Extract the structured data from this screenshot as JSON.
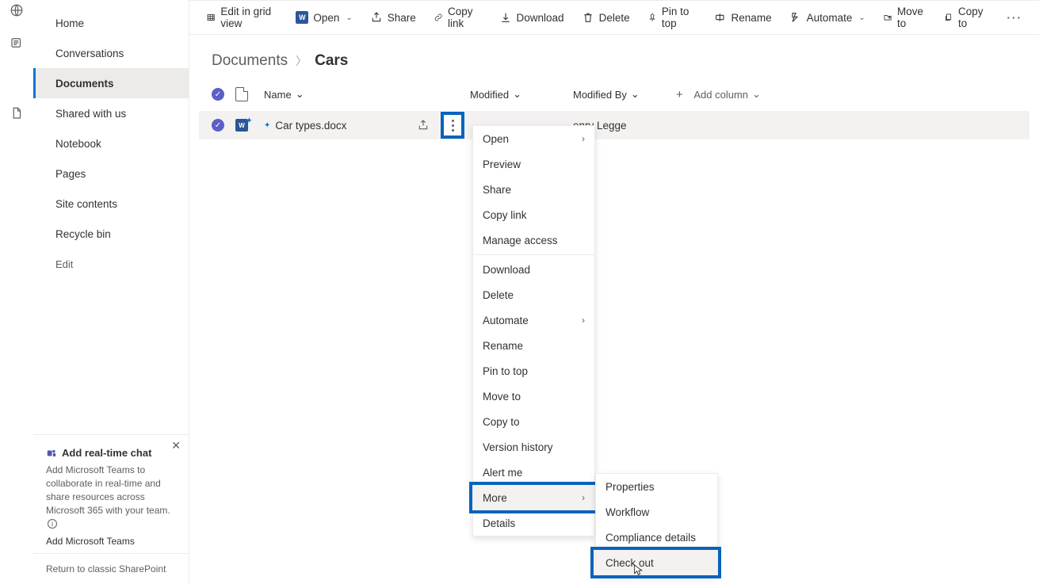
{
  "sidebar": {
    "items": [
      {
        "label": "Home"
      },
      {
        "label": "Conversations"
      },
      {
        "label": "Documents"
      },
      {
        "label": "Shared with us"
      },
      {
        "label": "Notebook"
      },
      {
        "label": "Pages"
      },
      {
        "label": "Site contents"
      },
      {
        "label": "Recycle bin"
      }
    ],
    "edit_label": "Edit"
  },
  "promo": {
    "title": "Add real-time chat",
    "body": "Add Microsoft Teams to collaborate in real-time and share resources across Microsoft 365 with your team.",
    "link": "Add Microsoft Teams"
  },
  "return_link": "Return to classic SharePoint",
  "toolbar": {
    "edit_grid": "Edit in grid view",
    "open": "Open",
    "share": "Share",
    "copylink": "Copy link",
    "download": "Download",
    "delete": "Delete",
    "pintop": "Pin to top",
    "rename": "Rename",
    "automate": "Automate",
    "moveto": "Move to",
    "copyto": "Copy to"
  },
  "breadcrumb": {
    "root": "Documents",
    "leaf": "Cars"
  },
  "columns": {
    "name": "Name",
    "modified": "Modified",
    "modifiedby": "Modified By",
    "addcol": "Add column"
  },
  "row": {
    "filename": "Car types.docx",
    "modifiedby": "enry Legge"
  },
  "context_menu": {
    "open": "Open",
    "preview": "Preview",
    "share": "Share",
    "copylink": "Copy link",
    "manageaccess": "Manage access",
    "download": "Download",
    "delete": "Delete",
    "automate": "Automate",
    "rename": "Rename",
    "pintop": "Pin to top",
    "moveto": "Move to",
    "copyto": "Copy to",
    "versionhistory": "Version history",
    "alertme": "Alert me",
    "more": "More",
    "details": "Details"
  },
  "submenu": {
    "properties": "Properties",
    "workflow": "Workflow",
    "compliance": "Compliance details",
    "checkout": "Check out"
  }
}
